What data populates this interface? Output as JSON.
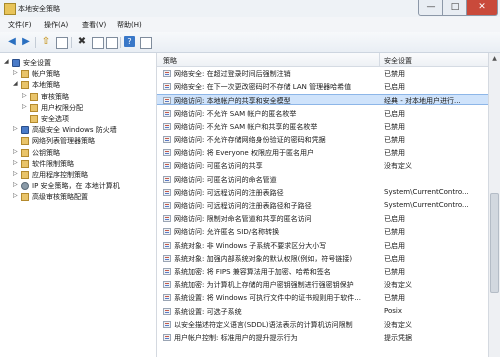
{
  "window": {
    "title": "本地安全策略",
    "min": "—",
    "max": "□",
    "close": "✕"
  },
  "menu": [
    "文件(F)",
    "操作(A)",
    "查看(V)",
    "帮助(H)"
  ],
  "toolbar": {
    "back": "◀",
    "forward": "▶",
    "up": "⇧",
    "del": "✖",
    "help": "?"
  },
  "tree": [
    {
      "label": "安全设置",
      "exp": "◢",
      "icon": "shield",
      "indent": 0
    },
    {
      "label": "帐户策略",
      "exp": "▷",
      "icon": "folder",
      "indent": 1
    },
    {
      "label": "本地策略",
      "exp": "◢",
      "icon": "folder",
      "indent": 1
    },
    {
      "label": "审核策略",
      "exp": "▷",
      "icon": "folder",
      "indent": 2
    },
    {
      "label": "用户权限分配",
      "exp": "▷",
      "icon": "folder",
      "indent": 2
    },
    {
      "label": "安全选项",
      "exp": "",
      "icon": "folder",
      "indent": 2
    },
    {
      "label": "高级安全 Windows 防火墙",
      "exp": "▷",
      "icon": "shield",
      "indent": 1
    },
    {
      "label": "网络列表管理器策略",
      "exp": "",
      "icon": "folder",
      "indent": 1
    },
    {
      "label": "公钥策略",
      "exp": "▷",
      "icon": "folder",
      "indent": 1
    },
    {
      "label": "软件限制策略",
      "exp": "▷",
      "icon": "folder",
      "indent": 1
    },
    {
      "label": "应用程序控制策略",
      "exp": "▷",
      "icon": "folder",
      "indent": 1
    },
    {
      "label": "IP 安全策略，在 本地计算机",
      "exp": "▷",
      "icon": "gear",
      "indent": 1
    },
    {
      "label": "高级审核策略配置",
      "exp": "▷",
      "icon": "folder",
      "indent": 1
    }
  ],
  "columns": {
    "policy": "策略",
    "setting": "安全设置"
  },
  "policies": [
    {
      "name": "网络安全: 在超过登录时间后强制注销",
      "value": "已禁用"
    },
    {
      "name": "网络安全: 在下一次更改密码时不存储 LAN 管理器哈希值",
      "value": "已启用"
    },
    {
      "name": "网络访问: 本地帐户的共享和安全模型",
      "value": "经典 - 对本地用户进行...",
      "selected": true
    },
    {
      "name": "网络访问: 不允许 SAM 帐户的匿名枚举",
      "value": "已启用"
    },
    {
      "name": "网络访问: 不允许 SAM 帐户和共享的匿名枚举",
      "value": "已禁用"
    },
    {
      "name": "网络访问: 不允许存储网络身份验证的密码和凭据",
      "value": "已禁用"
    },
    {
      "name": "网络访问: 将 Everyone 权限应用于匿名用户",
      "value": "已禁用"
    },
    {
      "name": "网络访问: 可匿名访问的共享",
      "value": "没有定义"
    },
    {
      "name": "网络访问: 可匿名访问的命名管道",
      "value": ""
    },
    {
      "name": "网络访问: 可远程访问的注册表路径",
      "value": "System\\CurrentContro..."
    },
    {
      "name": "网络访问: 可远程访问的注册表路径和子路径",
      "value": "System\\CurrentContro..."
    },
    {
      "name": "网络访问: 限制对命名管道和共享的匿名访问",
      "value": "已启用"
    },
    {
      "name": "网络访问: 允许匿名 SID/名称转换",
      "value": "已禁用"
    },
    {
      "name": "系统对象: 非 Windows 子系统不要求区分大小写",
      "value": "已启用"
    },
    {
      "name": "系统对象: 加强内部系统对象的默认权限(例如，符号链接)",
      "value": "已启用"
    },
    {
      "name": "系统加密: 将 FIPS 兼容算法用于加密、哈希和签名",
      "value": "已禁用"
    },
    {
      "name": "系统加密: 为计算机上存储的用户密钥强制进行强密钥保护",
      "value": "没有定义"
    },
    {
      "name": "系统设置: 将 Windows 可执行文件中的证书规则用于软件...",
      "value": "已禁用"
    },
    {
      "name": "系统设置: 可选子系统",
      "value": "Posix"
    },
    {
      "name": "以安全描述符定义语言(SDDL)语法表示的计算机访问限制",
      "value": "没有定义"
    },
    {
      "name": "用户帐户控制: 标准用户的提升提示行为",
      "value": "提示凭据"
    }
  ],
  "scroll": {
    "up": "▲"
  }
}
